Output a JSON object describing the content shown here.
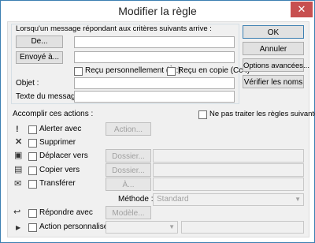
{
  "window": {
    "title": "Modifier la règle",
    "close_glyph": "✕"
  },
  "conditions": {
    "header": "Lorsqu'un message répondant aux critères suivants arrive :",
    "from_button": "De...",
    "sent_to_button": "Envoyé à...",
    "from_value": "",
    "sent_to_value": "",
    "personal_label": "Reçu personnellement (À :)",
    "cc_label": "Reçu en copie (Cc :)",
    "subject_label": "Objet :",
    "subject_value": "",
    "body_label": "Texte du message :",
    "body_value": ""
  },
  "side_buttons": {
    "ok": "OK",
    "cancel": "Annuler",
    "advanced": "Options avancées...",
    "check_names": "Vérifier les noms"
  },
  "actions": {
    "header": "Accomplir ces actions :",
    "stop_rules_label": "Ne pas traiter les règles suivantes",
    "alert_label": "Alerter avec",
    "alert_button": "Action...",
    "delete_label": "Supprimer",
    "move_label": "Déplacer vers",
    "move_button": "Dossier...",
    "copy_label": "Copier vers",
    "copy_button": "Dossier...",
    "forward_label": "Transférer",
    "forward_button": "À...",
    "method_label": "Méthode :",
    "method_value": "Standard",
    "reply_label": "Répondre avec",
    "reply_button": "Modèle...",
    "custom_label": "Action personnalisée"
  }
}
